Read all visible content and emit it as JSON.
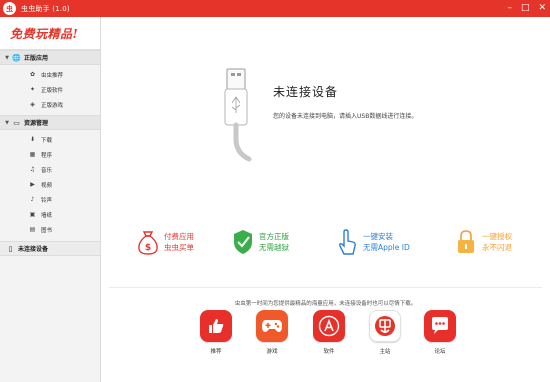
{
  "window": {
    "title": "虫虫助手 (1.0)",
    "logo_text": "虫",
    "controls": [
      "–",
      "□",
      "✕"
    ]
  },
  "sidebar": {
    "slogan": "免费玩精品!",
    "sections": [
      {
        "label": "正版应用",
        "icon": "globe-icon",
        "items": [
          {
            "label": "虫虫推荐",
            "icon": "bug-icon"
          },
          {
            "label": "正版软件",
            "icon": "star-icon"
          },
          {
            "label": "正版游戏",
            "icon": "gamepad-icon"
          }
        ]
      },
      {
        "label": "资源管理",
        "icon": "monitor-icon",
        "items": [
          {
            "label": "下载",
            "icon": "download-icon"
          },
          {
            "label": "程序",
            "icon": "apps-icon"
          },
          {
            "label": "音乐",
            "icon": "headphones-icon"
          },
          {
            "label": "视频",
            "icon": "video-icon"
          },
          {
            "label": "铃声",
            "icon": "bell-icon"
          },
          {
            "label": "墙纸",
            "icon": "image-icon"
          },
          {
            "label": "图书",
            "icon": "book-icon"
          }
        ]
      }
    ],
    "device": {
      "label": "未连接设备",
      "icon": "phone-icon"
    }
  },
  "main": {
    "status_title": "未连接设备",
    "status_desc": "您的设备未连接到电脑，请插入USB数据线进行连接。",
    "features": [
      {
        "line1": "付费应用",
        "line2": "虫虫买单",
        "icon": "money-bag-icon",
        "color": "#e5352b"
      },
      {
        "line1": "官方正版",
        "line2": "无需越狱",
        "icon": "shield-icon",
        "color": "#2e9e3e"
      },
      {
        "line1": "一键安装",
        "line2": "无需Apple ID",
        "icon": "hand-pointer-icon",
        "color": "#2d7fd3"
      },
      {
        "line1": "一键授权",
        "line2": "永不闪退",
        "icon": "lock-icon",
        "color": "#f0a032"
      }
    ],
    "intro": "虫虫第一时间为您提供最精品的海量应用，未连接设备时也可以尽情下载。",
    "shortcuts": [
      {
        "label": "推荐",
        "icon": "thumbs-up-icon"
      },
      {
        "label": "游戏",
        "icon": "gamepad-icon"
      },
      {
        "label": "软件",
        "icon": "app-store-icon"
      },
      {
        "label": "主站",
        "icon": "home-logo-icon"
      },
      {
        "label": "论坛",
        "icon": "chat-icon"
      }
    ]
  },
  "colors": {
    "brand": "#e5352b",
    "sidebar_bg": "#f3f3f3"
  }
}
